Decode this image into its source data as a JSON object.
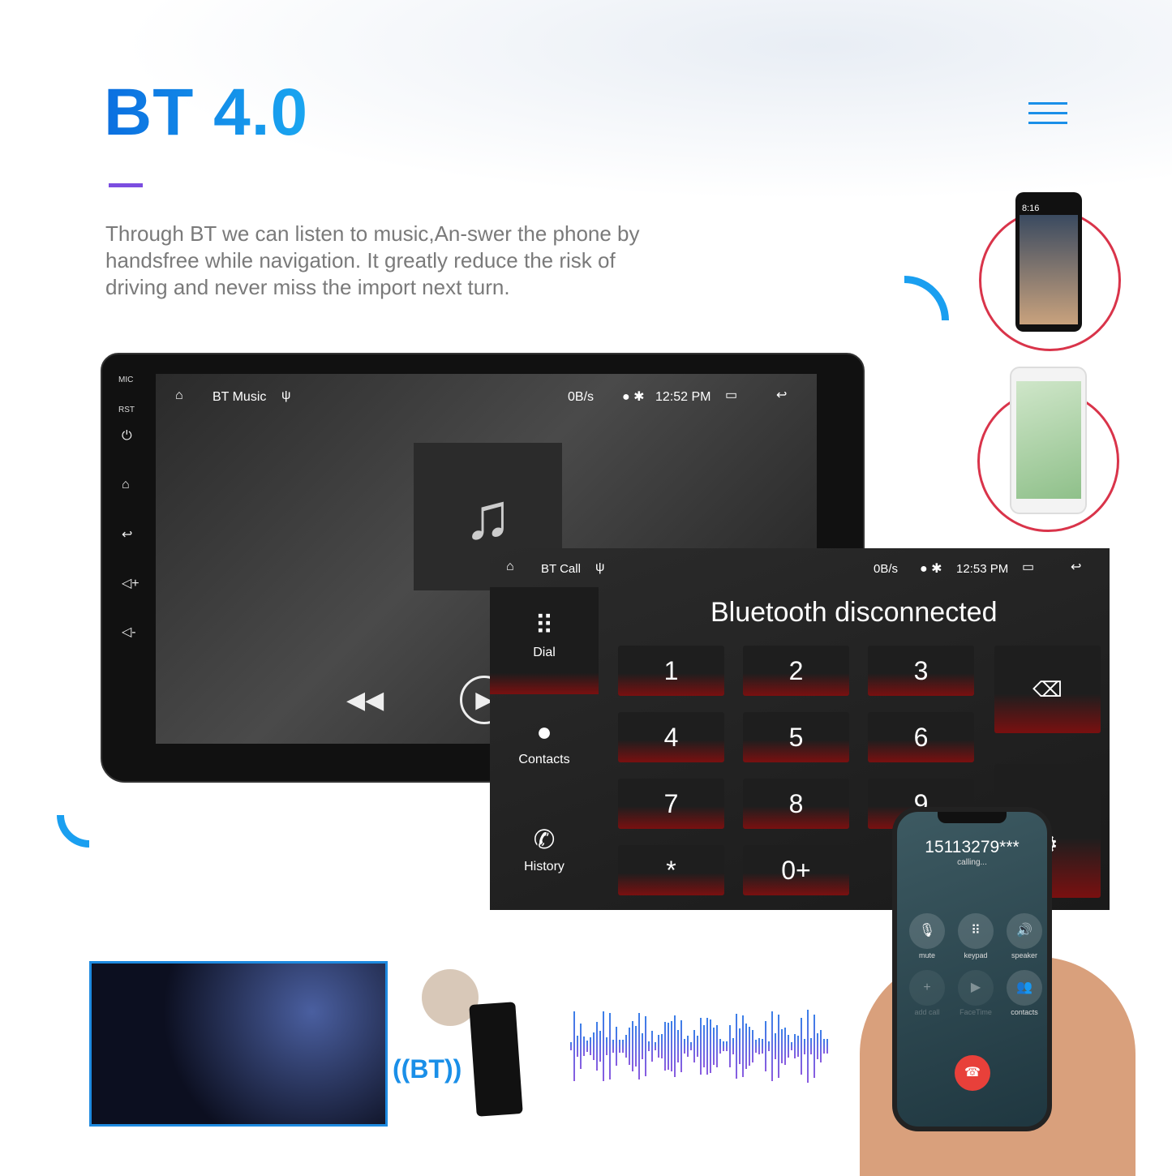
{
  "header": {
    "title": "BT 4.0",
    "description": "Through BT we can listen to music,An-swer the phone by handsfree while navigation. It greatly reduce the risk of driving and never miss the import next turn."
  },
  "music_screen": {
    "side_labels": {
      "mic": "MIC",
      "rst": "RST"
    },
    "app_title": "BT Music",
    "speed": "0B/s",
    "time": "12:52 PM"
  },
  "call_screen": {
    "app_title": "BT Call",
    "speed": "0B/s",
    "time": "12:53 PM",
    "status": "Bluetooth disconnected",
    "nav": [
      {
        "label": "Dial",
        "icon": "dialpad-icon"
      },
      {
        "label": "Contacts",
        "icon": "person-icon"
      },
      {
        "label": "History",
        "icon": "call-history-icon"
      }
    ],
    "keys": [
      "1",
      "2",
      "3",
      "4",
      "5",
      "6",
      "7",
      "8",
      "9",
      "*",
      "0+"
    ]
  },
  "phone": {
    "number": "15113279***",
    "status": "calling...",
    "buttons": [
      "mute",
      "keypad",
      "speaker",
      "add call",
      "FaceTime",
      "contacts"
    ]
  },
  "phone_thumbs": {
    "time": "8:16"
  },
  "bt_label": "((BT))",
  "colors": {
    "accent": "#1a8fe8",
    "circle": "#d9344a",
    "dash": "#7b4de0"
  }
}
